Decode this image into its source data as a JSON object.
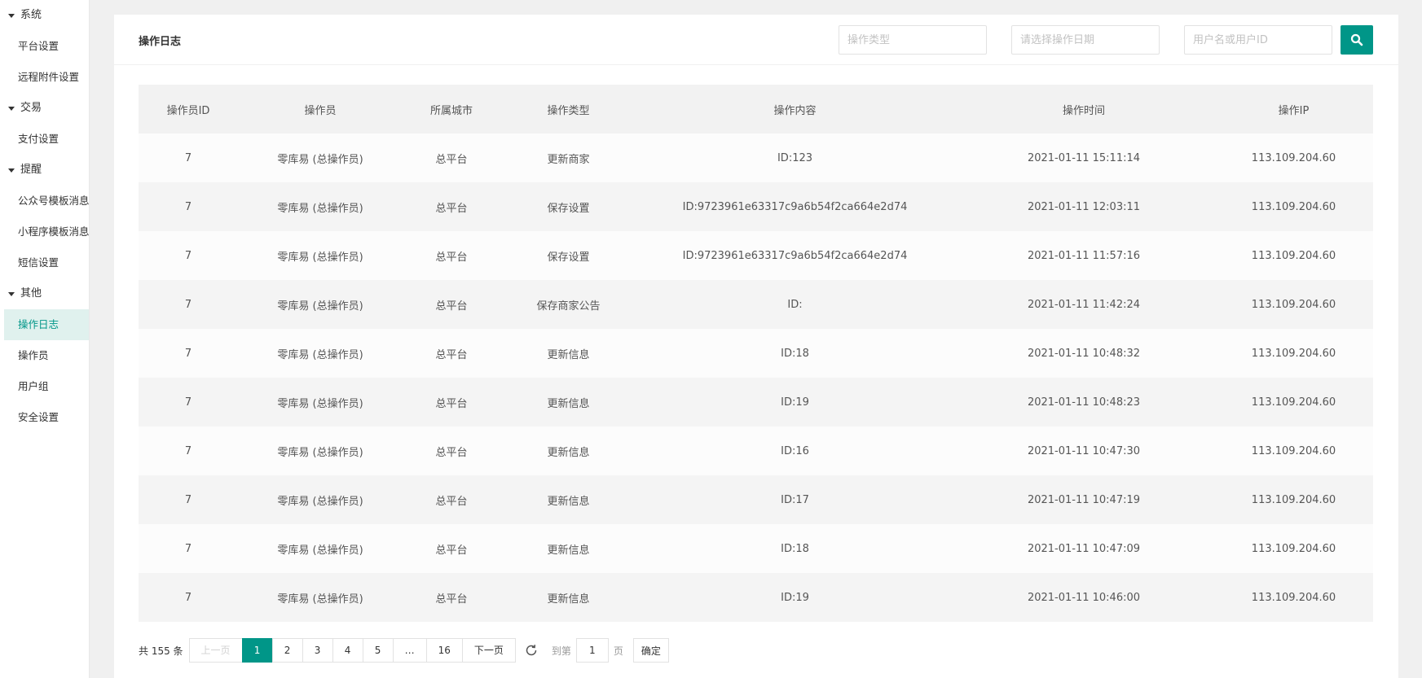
{
  "sidebar": {
    "groups": [
      {
        "title": "系统",
        "items": [
          "平台设置",
          "远程附件设置"
        ]
      },
      {
        "title": "交易",
        "items": [
          "支付设置"
        ]
      },
      {
        "title": "提醒",
        "items": [
          "公众号模板消息",
          "小程序模板消息",
          "短信设置"
        ]
      },
      {
        "title": "其他",
        "items": [
          "操作日志",
          "操作员",
          "用户组",
          "安全设置"
        ]
      }
    ],
    "active": "操作日志"
  },
  "header": {
    "title": "操作日志",
    "filters": {
      "type_placeholder": "操作类型",
      "date_placeholder": "请选择操作日期",
      "user_placeholder": "用户名或用户ID"
    }
  },
  "table": {
    "columns": [
      "操作员ID",
      "操作员",
      "所属城市",
      "操作类型",
      "操作内容",
      "操作时间",
      "操作IP"
    ],
    "rows": [
      [
        "7",
        "零库易 (总操作员)",
        "总平台",
        "更新商家",
        "ID:123",
        "2021-01-11 15:11:14",
        "113.109.204.60"
      ],
      [
        "7",
        "零库易 (总操作员)",
        "总平台",
        "保存设置",
        "ID:9723961e63317c9a6b54f2ca664e2d74",
        "2021-01-11 12:03:11",
        "113.109.204.60"
      ],
      [
        "7",
        "零库易 (总操作员)",
        "总平台",
        "保存设置",
        "ID:9723961e63317c9a6b54f2ca664e2d74",
        "2021-01-11 11:57:16",
        "113.109.204.60"
      ],
      [
        "7",
        "零库易 (总操作员)",
        "总平台",
        "保存商家公告",
        "ID:",
        "2021-01-11 11:42:24",
        "113.109.204.60"
      ],
      [
        "7",
        "零库易 (总操作员)",
        "总平台",
        "更新信息",
        "ID:18",
        "2021-01-11 10:48:32",
        "113.109.204.60"
      ],
      [
        "7",
        "零库易 (总操作员)",
        "总平台",
        "更新信息",
        "ID:19",
        "2021-01-11 10:48:23",
        "113.109.204.60"
      ],
      [
        "7",
        "零库易 (总操作员)",
        "总平台",
        "更新信息",
        "ID:16",
        "2021-01-11 10:47:30",
        "113.109.204.60"
      ],
      [
        "7",
        "零库易 (总操作员)",
        "总平台",
        "更新信息",
        "ID:17",
        "2021-01-11 10:47:19",
        "113.109.204.60"
      ],
      [
        "7",
        "零库易 (总操作员)",
        "总平台",
        "更新信息",
        "ID:18",
        "2021-01-11 10:47:09",
        "113.109.204.60"
      ],
      [
        "7",
        "零库易 (总操作员)",
        "总平台",
        "更新信息",
        "ID:19",
        "2021-01-11 10:46:00",
        "113.109.204.60"
      ]
    ]
  },
  "pager": {
    "total_text": "共 155 条",
    "prev": "上一页",
    "pages": [
      "1",
      "2",
      "3",
      "4",
      "5",
      "…",
      "16"
    ],
    "current": "1",
    "next": "下一页",
    "goto_label": "到第",
    "goto_value": "1",
    "page_unit": "页",
    "confirm": "确定"
  },
  "colors": {
    "accent": "#009688",
    "active_bg": "#e0f1ee"
  },
  "icons": {
    "search": "search-icon",
    "refresh": "refresh-icon",
    "group_caret": "caret-down-icon"
  }
}
